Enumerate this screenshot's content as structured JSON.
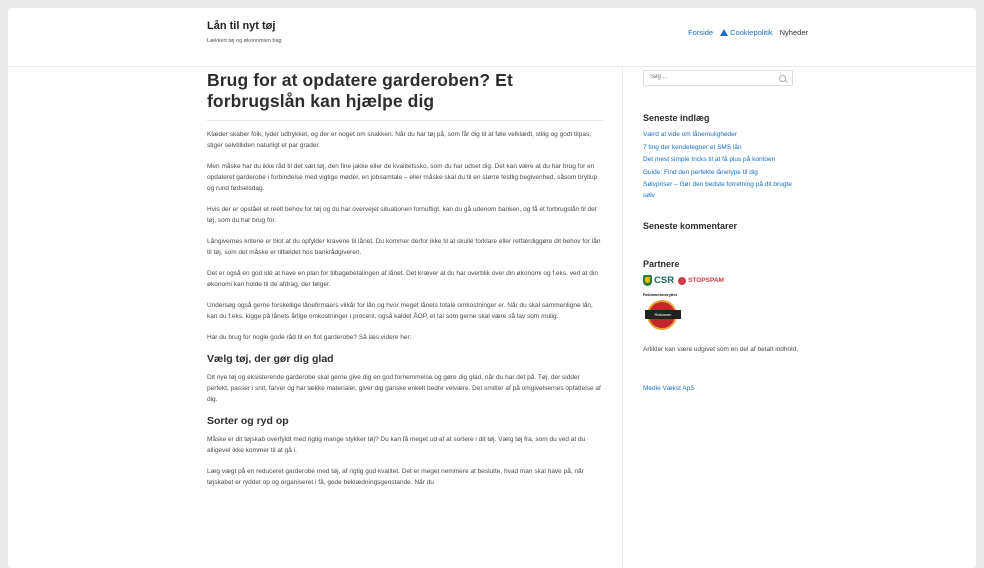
{
  "header": {
    "site_title": "Lån til nyt tøj",
    "site_description": "Lækkert tøj og økonomien bag",
    "nav": [
      {
        "label": "Forside",
        "icon": ""
      },
      {
        "label": "Cookiepolitik",
        "icon": "warning-icon"
      },
      {
        "label": "Nyheder",
        "icon": ""
      }
    ]
  },
  "article": {
    "title": "Brug for at opdatere garderoben? Et forbrugslån kan hjælpe dig",
    "paragraphs": [
      "Klæder skaber folk, lyder udtrykket, og der er noget om snakken. Når du har tøj på, som får dig til at føle velklædt, stilig og godt tilpas, stiger selvtilliden naturligt et par grader.",
      "Men måske har du ikke råd til det sæt tøj, den fine jakke eller de kvalitetssko, som du har udset dig. Det kan være at du har brug for en opdateret garderobe i forbindelse med vigtige møder, en jobsamtale – eller måske skal du til en større festlig begivenhed, såsom bryllup og rund fødselsdag.",
      "Hvis der er opstået et reelt behov for tøj og du har overvejet situationen fornuftigt, kan du gå udenom banken, og få et forbrugslån til det tøj, som du har brug for.",
      "Långivernes kriterie er blot at du opfylder kravene til lånet. Du kommer derfor ikke til at skulle forklare eller retfærdiggøre dit behov for lån til tøj, som det måske er tilfældet hos bankrådgiveren.",
      "Det er også en god idé at have en plan for tilbagebetalingen af lånet. Det kræver at du har overblik over din økonomi og f.eks. ved at din økonomi kan holde til de afdrag, der følger.",
      "Undersøg også gerne forskellige lånefirmaers vilkår for lån og hvor meget lånets totale omkostninger er. Når du skal sammenligne lån, kan du f.eks. kigge på lånets årlige omkostninger i procent, også kaldet ÅOP, et tal som gerne skal være så lav som mulig.",
      "Har du brug for nogle gode råd til en flot garderobe? Så læs videre her:"
    ],
    "section1_heading": "Vælg tøj, der gør dig glad",
    "section1_text": "Dit nye tøj og eksisterende garderobe skal gerne give dig en god fornemmelse og gøre dig glad, når du har det på. Tøj, der sidder perfekt, passer i snit, farver og har lække materialer, giver dig ganske enkelt bedre velvære. Det smitter  af på omgivelsernes opfattelse af dig.",
    "section2_heading": "Sorter og ryd op",
    "section2_text": "Måske er dit tøjskab overfyldt med rigtig mange stykker tøj? Du kan få meget ud af at sortere i dit tøj. Vælg tøj fra, som du ved at du alligevel ikke kommer til at gå i.",
    "section3_text": "Læg vægt på en reduceret garderobe med tøj, af rigtig god kvalitet. Det er meget nemmere at beslutte, hvad man skal have på, når tøjskabet er ryddet op og organiseret i få, gode beklædningsgenstande. Når du"
  },
  "sidebar": {
    "search_placeholder": "Søg ...",
    "recent_posts_title": "Seneste indlæg",
    "recent_posts": [
      "Værd at vide om lånemuligheder",
      "7 ting der kendetegner et SMS lån",
      "Det mest simple tricks til at få plus på kontoen",
      "Guide: Find den perfekte lånetype til dig",
      "Sølvpriser – Gør den bedste forretning på dit brugte sølv"
    ],
    "recent_comments_title": "Seneste kommentarer",
    "partners_title": "Partnere",
    "csr_label": "CSR",
    "stopspam_label": "STOPSPAM",
    "ad_badge_top": "Reklamebeskyttet",
    "ad_badge_ribbon": "Reklamer",
    "disclaimer": "Artikler kan være udgivet som en del af betalt indhold.",
    "footer_link": "Medie Vækst ApS"
  }
}
